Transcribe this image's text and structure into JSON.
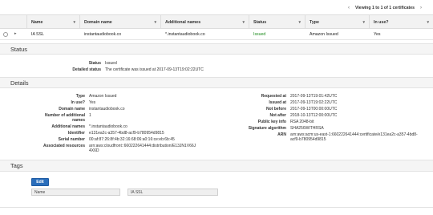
{
  "pager": {
    "text": "Viewing 1 to 1 of 1 certificates",
    "prev_icon": "chevron-left-icon",
    "next_icon": "chevron-right-icon"
  },
  "table": {
    "headers": [
      "Name",
      "Domain name",
      "Additional names",
      "Status",
      "Type",
      "In use?"
    ],
    "row": {
      "name": "IA SSL",
      "domain": "instantaudiobook.co",
      "additional": "*.instantaudiobook.co",
      "status": "Issued",
      "type": "Amazon Issued",
      "in_use": "Yes"
    }
  },
  "status_section": {
    "title": "Status",
    "status_label": "Status",
    "status_value": "Issued",
    "detailed_label": "Detailed status",
    "detailed_value": "The certificate was issued at 2017-09-13T19:02:22UTC"
  },
  "details_section": {
    "title": "Details",
    "left": [
      {
        "label": "Type",
        "value": "Amazon Issued"
      },
      {
        "label": "In use?",
        "value": "Yes"
      },
      {
        "label": "Domain name",
        "value": "instantaudiobook.co"
      },
      {
        "label": "Number of additional names",
        "value": "1"
      },
      {
        "label": "Additional names",
        "value": "*.instantaudiobook.co"
      },
      {
        "label": "Identifier",
        "value": "e131ea2c-a357-4bd8-acf9-b780954d9815"
      },
      {
        "label": "Serial number",
        "value": "00:af:87:26:8f:4b:32:16:68:06:a0:16:ce:eb:6b:45"
      },
      {
        "label": "Associated resources",
        "value": "arn:aws:cloudfront::660222641444:distribution/E13JN1V66J4X6D"
      }
    ],
    "right": [
      {
        "label": "Requested at",
        "value": "2017-09-13T19:01:42UTC"
      },
      {
        "label": "Issued at",
        "value": "2017-09-13T19:02:22UTC"
      },
      {
        "label": "Not before",
        "value": "2017-09-13T00:00:00UTC"
      },
      {
        "label": "Not after",
        "value": "2018-10-13T12:00:00UTC"
      },
      {
        "label": "Public key info",
        "value": "RSA 2048-bit"
      },
      {
        "label": "Signature algorithm",
        "value": "SHA256WITHRSA"
      },
      {
        "label": "ARN",
        "value": "arn:aws:acm:us-east-1:660222641444:certificate/e131ea2c-a357-4bd8-acf9-b780954d9815"
      }
    ]
  },
  "tags_section": {
    "title": "Tags",
    "edit_label": "Edit",
    "tag_key": "Name",
    "tag_value": "IA SSL"
  }
}
